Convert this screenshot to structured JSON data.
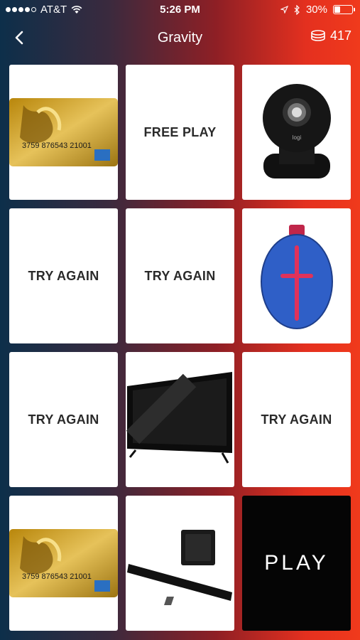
{
  "status": {
    "carrier": "AT&T",
    "time": "5:26 PM",
    "battery": "30%"
  },
  "nav": {
    "title": "Gravity",
    "coins": "417"
  },
  "tiles": [
    {
      "kind": "image",
      "icon": "gift-card-image",
      "card_number": "3759 876543 21001"
    },
    {
      "kind": "text",
      "label": "FREE PLAY"
    },
    {
      "kind": "image",
      "icon": "security-camera-image",
      "brand": "logi"
    },
    {
      "kind": "text",
      "label": "TRY AGAIN"
    },
    {
      "kind": "text",
      "label": "TRY AGAIN"
    },
    {
      "kind": "image",
      "icon": "bluetooth-speaker-image"
    },
    {
      "kind": "text",
      "label": "TRY AGAIN"
    },
    {
      "kind": "image",
      "icon": "television-image"
    },
    {
      "kind": "text",
      "label": "TRY AGAIN"
    },
    {
      "kind": "image",
      "icon": "gift-card-image",
      "card_number": "3759 876543 21001"
    },
    {
      "kind": "image",
      "icon": "soundbar-image"
    },
    {
      "kind": "play",
      "label": "PLAY"
    }
  ]
}
